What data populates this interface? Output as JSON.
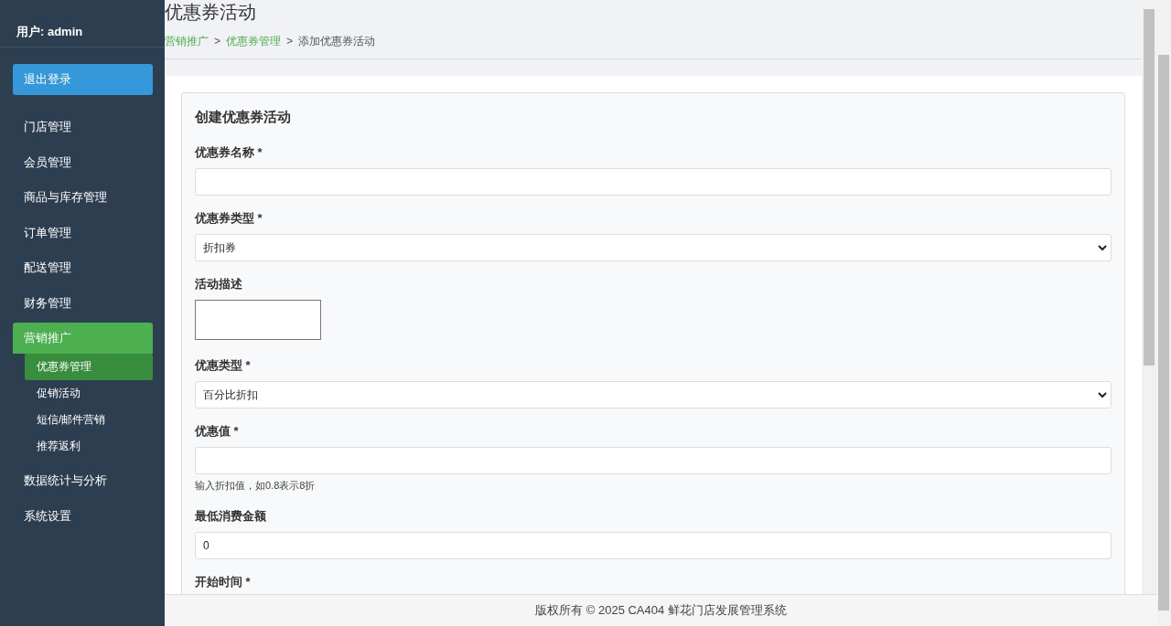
{
  "sidebar": {
    "user": "用户: admin",
    "logout_button": "退出登录",
    "items": [
      {
        "label": "门店管理",
        "selected": false
      },
      {
        "label": "会员管理",
        "selected": false
      },
      {
        "label": "商品与库存管理",
        "selected": false
      },
      {
        "label": "订单管理",
        "selected": false
      },
      {
        "label": "配送管理",
        "selected": false
      },
      {
        "label": "财务管理",
        "selected": false
      },
      {
        "label": "营销推广",
        "selected": true,
        "children": [
          {
            "label": "优惠券管理",
            "selected": true
          },
          {
            "label": "促销活动",
            "selected": false
          },
          {
            "label": "短信/邮件营销",
            "selected": false
          },
          {
            "label": "推荐返利",
            "selected": false
          }
        ]
      },
      {
        "label": "数据统计与分析",
        "selected": false
      },
      {
        "label": "系统设置",
        "selected": false
      }
    ]
  },
  "page": {
    "title": "优惠券活动",
    "breadcrumb": [
      {
        "label": "营销推广",
        "link": true
      },
      {
        "label": "优惠券管理",
        "link": true
      },
      {
        "label": "添加优惠券活动",
        "link": false
      }
    ],
    "separator": ">"
  },
  "form": {
    "title": "创建优惠券活动",
    "fields": [
      {
        "label": "优惠券名称 *",
        "kind": "text"
      },
      {
        "label": "优惠券类型 *",
        "kind": "select",
        "value": "折扣券"
      },
      {
        "label": "活动描述",
        "kind": "textarea"
      },
      {
        "label": "优惠类型 *",
        "kind": "select",
        "value": "百分比折扣"
      },
      {
        "label": "优惠值 *",
        "kind": "text",
        "help": "输入折扣值，如0.8表示8折"
      },
      {
        "label": "最低消费金额",
        "kind": "text",
        "value": "0"
      },
      {
        "label": "开始时间 *",
        "kind": "cut"
      }
    ]
  },
  "footer": "版权所有 © 2025 CA404 鲜花门店发展管理系统"
}
